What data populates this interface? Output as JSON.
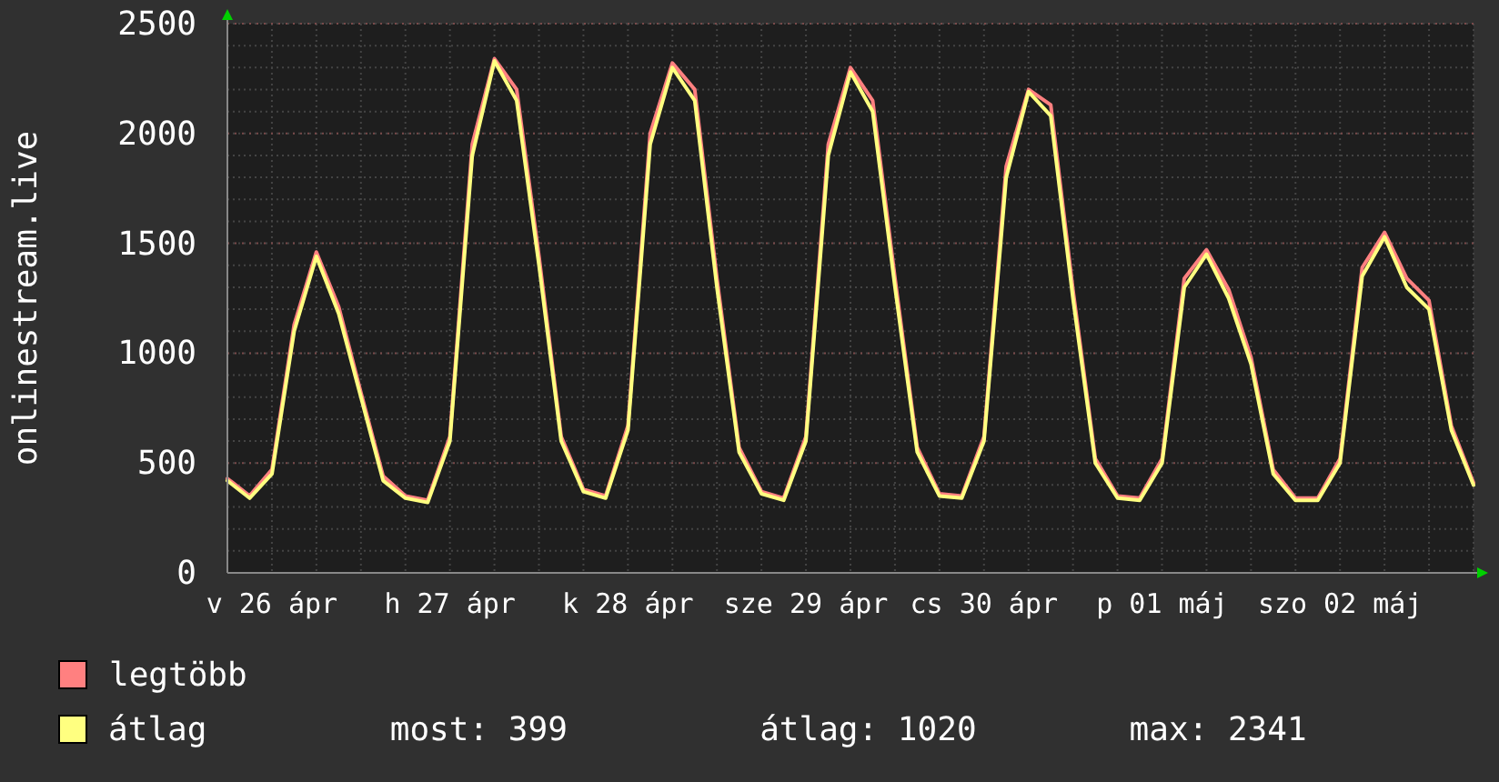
{
  "chart": {
    "chart_data": {
      "type": "line",
      "ylabel": "onlinestream.live",
      "categories": [
        null,
        null,
        "v 26 ápr",
        null,
        null,
        null,
        null,
        null,
        null,
        null,
        "h 27 ápr",
        null,
        null,
        null,
        null,
        null,
        null,
        null,
        "k 28 ápr",
        null,
        null,
        null,
        null,
        null,
        null,
        null,
        "sze 29 ápr",
        null,
        null,
        null,
        null,
        null,
        null,
        null,
        "cs 30 ápr",
        null,
        null,
        null,
        null,
        null,
        null,
        null,
        "p 01 máj",
        null,
        null,
        null,
        null,
        null,
        null,
        null,
        "szo 02 máj",
        null,
        null,
        null,
        null,
        null,
        null
      ],
      "series": [
        {
          "name": "legtöbb",
          "color": "#ff8080",
          "values": [
            430,
            350,
            470,
            1130,
            1460,
            1210,
            820,
            440,
            350,
            330,
            620,
            1950,
            2340,
            2200,
            1440,
            620,
            380,
            350,
            670,
            2000,
            2320,
            2200,
            1340,
            570,
            370,
            340,
            620,
            1950,
            2300,
            2150,
            1340,
            570,
            360,
            350,
            620,
            1850,
            2200,
            2130,
            1290,
            520,
            350,
            340,
            520,
            1340,
            1470,
            1290,
            980,
            470,
            340,
            340,
            520,
            1390,
            1550,
            1340,
            1240,
            670,
            410
          ]
        },
        {
          "name": "átlag",
          "color": "#ffff80",
          "values": [
            420,
            340,
            450,
            1100,
            1440,
            1180,
            800,
            420,
            340,
            320,
            600,
            1900,
            2330,
            2150,
            1400,
            600,
            370,
            340,
            650,
            1950,
            2300,
            2150,
            1300,
            550,
            360,
            330,
            600,
            1900,
            2280,
            2100,
            1300,
            550,
            350,
            340,
            600,
            1800,
            2190,
            2080,
            1250,
            500,
            340,
            330,
            500,
            1300,
            1450,
            1250,
            950,
            450,
            330,
            330,
            500,
            1350,
            1530,
            1300,
            1200,
            650,
            400
          ]
        }
      ],
      "ylim": [
        0,
        2500
      ],
      "grid": true,
      "yticks": [
        0,
        500,
        1000,
        1500,
        2000,
        2500
      ]
    }
  },
  "legend_stats": [
    "most: 399",
    "átlag: 1020",
    "max: 2341"
  ]
}
